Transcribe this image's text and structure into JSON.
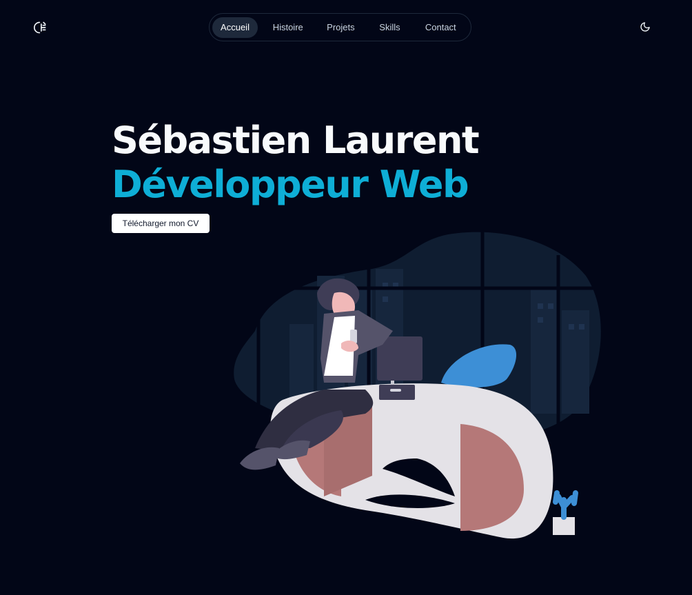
{
  "header": {
    "logo_icon": "chart-logo-icon",
    "nav": [
      {
        "label": "Accueil",
        "active": true
      },
      {
        "label": "Histoire",
        "active": false
      },
      {
        "label": "Projets",
        "active": false
      },
      {
        "label": "Skills",
        "active": false
      },
      {
        "label": "Contact",
        "active": false
      }
    ],
    "theme_icon": "moon-icon"
  },
  "hero": {
    "name": "Sébastien Laurent",
    "role": "Développeur Web",
    "cv_button": "Télécharger mon CV"
  },
  "colors": {
    "background": "#020617",
    "accent": "#0eaed6",
    "nav_border": "#1e293b",
    "nav_active_bg": "#1e293b"
  }
}
